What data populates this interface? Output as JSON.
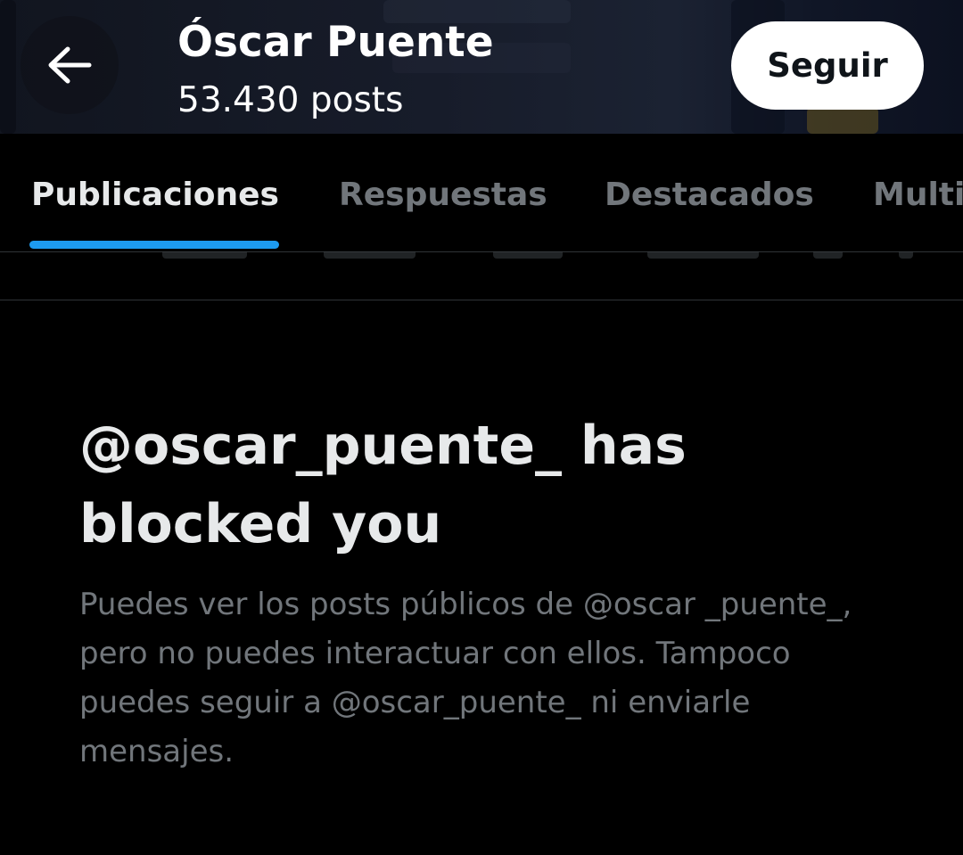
{
  "header": {
    "back_icon": "arrow-left-icon",
    "title": "Óscar Puente",
    "subtitle": "53.430 posts",
    "follow_label": "Seguir"
  },
  "tabs": [
    {
      "label": "Publicaciones",
      "active": true
    },
    {
      "label": "Respuestas",
      "active": false
    },
    {
      "label": "Destacados",
      "active": false
    },
    {
      "label": "Multi",
      "active": false
    }
  ],
  "blocked": {
    "title": "@oscar_puente_ has blocked you",
    "body": "Puedes ver los posts públicos de @oscar _puente_, pero no puedes interactuar con ellos. Tampoco puedes seguir a @oscar_puente_ ni enviarle mensajes."
  },
  "colors": {
    "background": "#000000",
    "primary_text": "#e7e9ea",
    "secondary_text": "#71767b",
    "accent": "#1d9bf0",
    "divider": "#2f3336",
    "button_bg": "#ffffff"
  }
}
